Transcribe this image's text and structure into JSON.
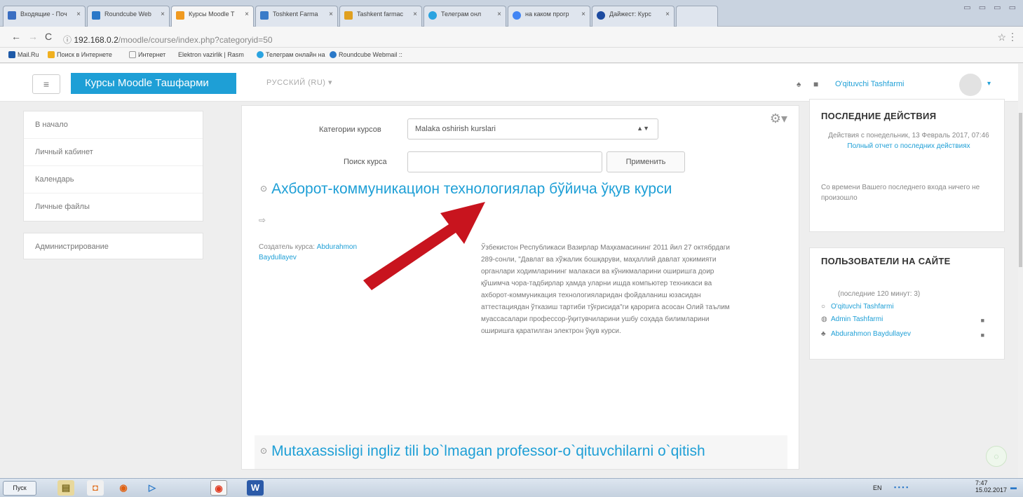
{
  "browser": {
    "tabs": [
      {
        "label": "Входящие - Поч",
        "color": "#3a6ec2"
      },
      {
        "label": "Roundcube Web",
        "color": "#2a78c8"
      },
      {
        "label": "Курсы Moodle T",
        "color": "#f09a20"
      },
      {
        "label": "Toshkent Farma",
        "color": "#3a7bc8"
      },
      {
        "label": "Tashkent farmac",
        "color": "#e0a020"
      },
      {
        "label": "Телеграм онл",
        "color": "#2aa3e0"
      },
      {
        "label": "на каком прогр",
        "color": "#4285f4"
      },
      {
        "label": "Дайжест: Курс",
        "color": "#1d4ba0"
      }
    ],
    "url_host": "192.168.0.2",
    "url_path": "/moodle/course/index.php?categoryid=50",
    "bookmarks": [
      "Mail.Ru",
      "Поиск в Интернете",
      "Интернет",
      "Elektron vazirlik | Rasm",
      "Телеграм онлайн на",
      "Roundcube Webmail ::"
    ]
  },
  "navbar": {
    "menu_icon": "≡",
    "brand": "Курсы Moodle Ташфарми",
    "language": "РУССКИЙ (RU) ▾",
    "username": "O'qituvchi Tashfarmi"
  },
  "left_nav": {
    "items": [
      "В начало",
      "Личный кабинет",
      "Календарь",
      "Личные файлы"
    ],
    "admin": "Администрирование"
  },
  "main": {
    "category_label": "Категории курсов",
    "category_value": "Malaka oshirish kurslari",
    "search_label": "Поиск курса",
    "search_placeholder": "",
    "apply_button": "Применить",
    "course1": {
      "title": "Ахборот-коммуникацион технологиялар бўйича ўқув курси",
      "creator_label": "Создатель курса:",
      "creator_name": "Abdurahmon Baydullayev",
      "summary": "Ўзбекистон Республикаси Вазирлар Маҳкамасининг 2011 йил 27 октябрдаги 289-сонли, \"Давлат ва хўжалик бошқаруви, маҳаллий давлат ҳокимияти органлари ходимларининг малакаси ва кўникмаларини оширишга доир қўшимча чора-тадбирлар ҳамда уларни ишда компьютер техникаси ва ахборот-коммуникация технологияларидан фойдаланиш юзасидан аттестациядан ўтказиш тартиби тўғрисида\"ги қарорига асосан Олий таълим муассасалари профессор-ўқитувчиларини ушбу соҳада билимларини оширишга қаратилган электрон ўқув курси."
    },
    "course2": {
      "title": "Mutaxassisligi ingliz tili bo`lmagan professor-o`qituvchilarni o`qitish"
    }
  },
  "recent_activity": {
    "title": "ПОСЛЕДНИЕ ДЕЙСТВИЯ",
    "since": "Действия с понедельник, 13 Февраль 2017, 07:46",
    "full_report": "Полный отчет о последних действиях",
    "nothing": "Со времени Вашего последнего входа ничего не произошло"
  },
  "online_users": {
    "title": "ПОЛЬЗОВАТЕЛИ НА САЙТЕ",
    "period": "(последние 120 минут: 3)",
    "users": [
      "O'qituvchi Tashfarmi",
      "Admin Tashfarmi",
      "Abdurahmon Baydullayev"
    ]
  },
  "taskbar": {
    "start": "Пуск",
    "lang": "EN",
    "time": "7:47",
    "date": "15.02.2017"
  }
}
